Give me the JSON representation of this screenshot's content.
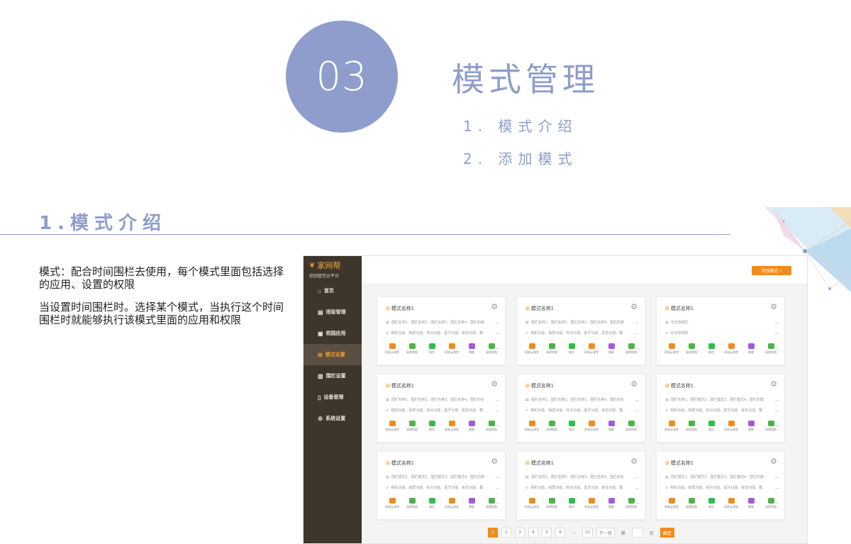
{
  "section": {
    "number": "03",
    "title": "模式管理",
    "items": [
      "1. 模式介绍",
      "2. 添加模式"
    ]
  },
  "subsection": {
    "title": "1.模式介绍"
  },
  "description": [
    "模式：配合时间围栏去使用，每个模式里面包括选择的应用、设置的权限",
    "当设置时间围栏时。选择某个模式，当执行这个时间围栏时就能够执行该模式里面的应用和权限"
  ],
  "app": {
    "logo": {
      "name": "家网帮",
      "subtitle": "校园管控云平台"
    },
    "nav": [
      {
        "icon": "⌂",
        "label": "首页"
      },
      {
        "icon": "▤",
        "label": "班级管理"
      },
      {
        "icon": "▣",
        "label": "校园应用"
      },
      {
        "icon": "⊞",
        "label": "模式设置"
      },
      {
        "icon": "▥",
        "label": "围栏设置"
      },
      {
        "icon": "▯",
        "label": "设备管理"
      },
      {
        "icon": "⚙",
        "label": "系统设置"
      }
    ],
    "active_nav": 3,
    "add_button": "添加模式 +",
    "app_icons": [
      {
        "label": "网易云课堂",
        "color": "#f08c1c"
      },
      {
        "label": "高德地图",
        "color": "#4fb34a"
      },
      {
        "label": "微信",
        "color": "#2fbf4a"
      },
      {
        "label": "网易云课堂",
        "color": "#f08c1c"
      },
      {
        "label": "播客",
        "color": "#a45ad9"
      },
      {
        "label": "高德地图",
        "color": "#4fb34a"
      }
    ],
    "cards": [
      {
        "title": "模式名称1",
        "fence": "围栏名称1、围栏名称2、围栏名称3、围栏名称4、围栏的被",
        "perm": "相机功能、锁屏功能、热点功能、蓝牙功能、来音功能、截"
      },
      {
        "title": "模式名称1",
        "fence": "围栏名称1、围栏名称2、围栏名称3、围栏名称4、围栏的被",
        "perm": "相机功能、锁屏功能、热点功能、蓝牙功能、来音功能、截"
      },
      {
        "title": "模式名称1",
        "fence": "无应用围栏",
        "perm": "无无权限限"
      },
      {
        "title": "模式名称1",
        "fence": "围栏名称1、围栏名称2、围栏名称3、围栏名称4、围栏的名",
        "perm": "相机功能、锁屏功能、热点功能、蓝牙功能、来音功能、截"
      },
      {
        "title": "模式名称1",
        "fence": "围栏名称1、围栏名称2、围栏名称3、围栏名称4、围栏的名",
        "perm": "相机功能、锁屏功能、热点功能、蓝牙功能、来音功能、截"
      },
      {
        "title": "模式名称1",
        "fence": "围栏名称1、围栏模式2、围栏模式3、围栏模式4、围栏的模",
        "perm": "相机功能、锁屏功能、热点功能、蓝牙功能、来音功能、截"
      },
      {
        "title": "模式名称1",
        "fence": "围栏模式1、围栏模式2、围栏模式3、围栏模式4、围栏的模",
        "perm": "相机功能、锁屏功能、热点功能、蓝牙功能、来音功能、截"
      },
      {
        "title": "模式名称1",
        "fence": "围栏名称1、围栏名称2、围栏名称3、围栏名称4、围栏的名",
        "perm": "相机功能、锁屏功能、热点功能、蓝牙功能、来音功能、截"
      },
      {
        "title": "模式名称1",
        "fence": "围栏模式1、围栏模式2、围栏模式3、围栏模式4、围栏的模",
        "perm": "相机功能、锁屏功能、热点功能、蓝牙功能、来音功能、截"
      }
    ],
    "more": "...",
    "pager": {
      "pages": [
        "1",
        "2",
        "3",
        "4",
        "5",
        "6",
        "...",
        "10"
      ],
      "current": "1",
      "next": "下一页",
      "goto_prefix": "第",
      "goto_suffix": "页",
      "confirm": "确定"
    }
  }
}
